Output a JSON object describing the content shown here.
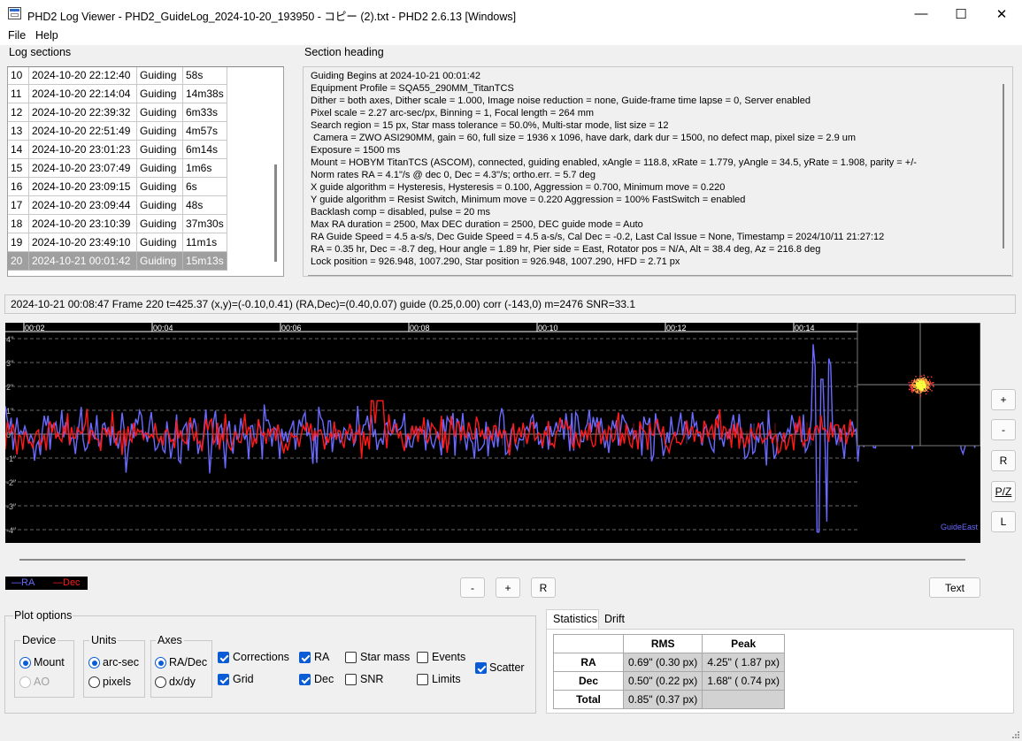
{
  "window": {
    "title": "PHD2 Log Viewer - PHD2_GuideLog_2024-10-20_193950 - コピー (2).txt - PHD2 2.6.13 [Windows]",
    "min_glyph": "—",
    "max_glyph": "☐",
    "close_glyph": "✕"
  },
  "menu": {
    "file": "File",
    "help": "Help"
  },
  "log_sections": {
    "label": "Log sections",
    "rows": [
      {
        "num": "10",
        "date": "2024-10-20 22:12:40",
        "type": "Guiding",
        "dur": "58s"
      },
      {
        "num": "11",
        "date": "2024-10-20 22:14:04",
        "type": "Guiding",
        "dur": "14m38s"
      },
      {
        "num": "12",
        "date": "2024-10-20 22:39:32",
        "type": "Guiding",
        "dur": "6m33s"
      },
      {
        "num": "13",
        "date": "2024-10-20 22:51:49",
        "type": "Guiding",
        "dur": "4m57s"
      },
      {
        "num": "14",
        "date": "2024-10-20 23:01:23",
        "type": "Guiding",
        "dur": "6m14s"
      },
      {
        "num": "15",
        "date": "2024-10-20 23:07:49",
        "type": "Guiding",
        "dur": "1m6s"
      },
      {
        "num": "16",
        "date": "2024-10-20 23:09:15",
        "type": "Guiding",
        "dur": "6s"
      },
      {
        "num": "17",
        "date": "2024-10-20 23:09:44",
        "type": "Guiding",
        "dur": "48s"
      },
      {
        "num": "18",
        "date": "2024-10-20 23:10:39",
        "type": "Guiding",
        "dur": "37m30s"
      },
      {
        "num": "19",
        "date": "2024-10-20 23:49:10",
        "type": "Guiding",
        "dur": "11m1s"
      },
      {
        "num": "20",
        "date": "2024-10-21 00:01:42",
        "type": "Guiding",
        "dur": "15m13s"
      }
    ],
    "selected_index": 10
  },
  "section_heading": {
    "label": "Section heading",
    "lines": [
      "Guiding Begins at 2024-10-21 00:01:42",
      "Equipment Profile = SQA55_290MM_TitanTCS",
      "Dither = both axes, Dither scale = 1.000, Image noise reduction = none, Guide-frame time lapse = 0, Server enabled",
      "Pixel scale = 2.27 arc-sec/px, Binning = 1, Focal length = 264 mm",
      "Search region = 15 px, Star mass tolerance = 50.0%, Multi-star mode, list size = 12",
      " Camera = ZWO ASI290MM, gain = 60, full size = 1936 x 1096, have dark, dark dur = 1500, no defect map, pixel size = 2.9 um",
      "Exposure = 1500 ms",
      "Mount = HOBYM TitanTCS (ASCOM), connected, guiding enabled, xAngle = 118.8, xRate = 1.779, yAngle = 34.5, yRate = 1.908, parity = +/-",
      "Norm rates RA = 4.1\"/s @ dec 0, Dec = 4.3\"/s; ortho.err. = 5.7 deg",
      "X guide algorithm = Hysteresis, Hysteresis = 0.100, Aggression = 0.700, Minimum move = 0.220",
      "Y guide algorithm = Resist Switch, Minimum move = 0.220 Aggression = 100% FastSwitch = enabled",
      "Backlash comp = disabled, pulse = 20 ms",
      "Max RA duration = 2500, Max DEC duration = 2500, DEC guide mode = Auto",
      "RA Guide Speed = 4.5 a-s/s, Dec Guide Speed = 4.5 a-s/s, Cal Dec = -0.2, Last Cal Issue = None, Timestamp = 2024/10/11 21:27:12",
      "RA = 0.35 hr, Dec = -8.7 deg, Hour angle = 1.89 hr, Pier side = East, Rotator pos = N/A, Alt = 38.4 deg, Az = 216.8 deg",
      "Lock position = 926.948, 1007.290, Star position = 926.948, 1007.290, HFD = 2.71 px"
    ]
  },
  "status_line": "2024-10-21 00:08:47 Frame 220 t=425.37 (x,y)=(-0.10,0.41) (RA,Dec)=(0.40,0.07) guide (0.25,0.00) corr (-143,0) m=2476 SNR=33.1",
  "plot": {
    "time_labels": [
      "00:02",
      "00:04",
      "00:06",
      "00:08",
      "00:10",
      "00:12",
      "00:14"
    ],
    "y_labels": [
      "4\"",
      "3\"",
      "2\"",
      "1\"",
      "0\"",
      "-1\"",
      "-2\"",
      "-3\"",
      "-4\""
    ],
    "guide_label": "GuideEast",
    "colors": {
      "background": "#000000",
      "ra": "#6a6aff",
      "dec": "#ff1a1a",
      "grid": "#8a8a8a",
      "scatter_star": "#ffff40"
    }
  },
  "side_buttons": {
    "zoom_in": "+",
    "zoom_out": "-",
    "reset": "R",
    "pan_zoom": "P/Z",
    "limits": "L"
  },
  "legend": {
    "ra": "—RA",
    "dec": "—Dec"
  },
  "bottom_buttons": {
    "minus": "-",
    "plus": "+",
    "reset": "R",
    "text": "Text"
  },
  "plot_options": {
    "label": "Plot options",
    "device": {
      "label": "Device",
      "mount": "Mount",
      "ao": "AO",
      "selected": "Mount"
    },
    "units": {
      "label": "Units",
      "arcsec": "arc-sec",
      "pixels": "pixels",
      "selected": "arc-sec"
    },
    "axes": {
      "label": "Axes",
      "radec": "RA/Dec",
      "dxdy": "dx/dy",
      "selected": "RA/Dec"
    },
    "checks": [
      {
        "key": "corrections",
        "label": "Corrections",
        "checked": true
      },
      {
        "key": "grid",
        "label": "Grid",
        "checked": true
      },
      {
        "key": "ra",
        "label": "RA",
        "checked": true
      },
      {
        "key": "dec",
        "label": "Dec",
        "checked": true
      },
      {
        "key": "star_mass",
        "label": "Star mass",
        "checked": false
      },
      {
        "key": "snr",
        "label": "SNR",
        "checked": false
      },
      {
        "key": "events",
        "label": "Events",
        "checked": false
      },
      {
        "key": "limits",
        "label": "Limits",
        "checked": false
      },
      {
        "key": "scatter",
        "label": "Scatter",
        "checked": true
      }
    ]
  },
  "tabs": {
    "statistics": "Statistics",
    "drift": "Drift",
    "active": "Statistics"
  },
  "statistics": {
    "headers": [
      "RMS",
      "Peak"
    ],
    "rows": [
      {
        "label": "RA",
        "rms": "0.69\" (0.30 px)",
        "peak": "4.25\" ( 1.87 px)"
      },
      {
        "label": "Dec",
        "rms": "0.50\" (0.22 px)",
        "peak": "1.68\" ( 0.74 px)"
      },
      {
        "label": "Total",
        "rms": "0.85\" (0.37 px)",
        "peak": ""
      }
    ]
  }
}
